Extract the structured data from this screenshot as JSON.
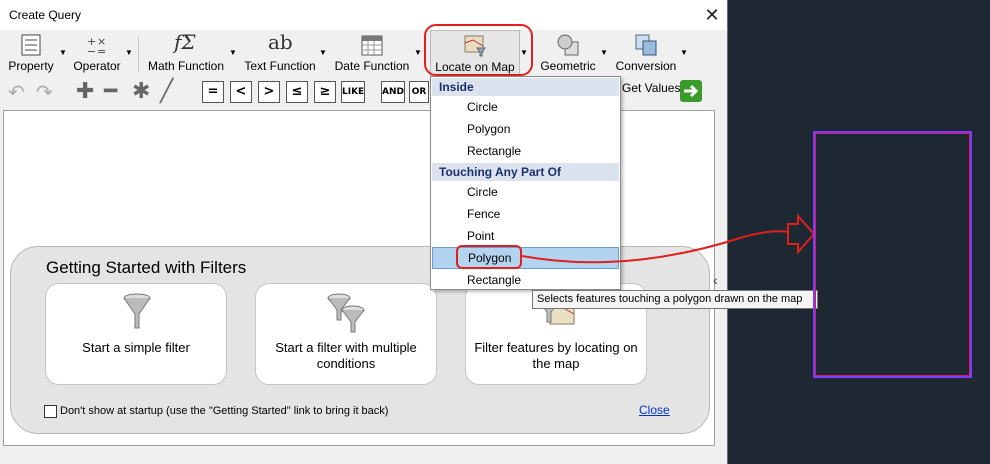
{
  "window": {
    "title": "Create Query",
    "close_glyph": "✕"
  },
  "ribbon": {
    "items": [
      {
        "label": "Property",
        "icon": "property-icon"
      },
      {
        "label": "Operator",
        "icon": "operator-icon"
      },
      {
        "label": "Math Function",
        "icon": "math-function-icon",
        "glyph": "fΣ"
      },
      {
        "label": "Text Function",
        "icon": "text-function-icon",
        "glyph": "ab"
      },
      {
        "label": "Date Function",
        "icon": "date-function-icon"
      },
      {
        "label": "Locate on Map",
        "icon": "locate-on-map-icon"
      },
      {
        "label": "Geometric",
        "icon": "geometric-icon"
      },
      {
        "label": "Conversion",
        "icon": "conversion-icon"
      }
    ]
  },
  "toolbar": {
    "get_values": "Get Values",
    "buttons": [
      "=",
      "<",
      ">",
      "≤",
      "≥",
      "LIKE",
      "AND",
      "OR"
    ]
  },
  "dropdown": {
    "section_inside": "Inside",
    "inside_items": [
      "Circle",
      "Polygon",
      "Rectangle"
    ],
    "section_touching": "Touching Any Part Of",
    "touching_items": [
      "Circle",
      "Fence",
      "Point",
      "Polygon",
      "Rectangle"
    ],
    "highlighted": "Polygon"
  },
  "tooltip": "Selects features touching a polygon drawn on the map",
  "getting_started": {
    "title": "Getting Started with Filters",
    "cards": [
      "Start a simple filter",
      "Start a filter with multiple conditions",
      "Filter features by locating on the map"
    ],
    "dont_show": "Don't show at startup (use the \"Getting Started\" link to bring it back)",
    "close": "Close"
  },
  "colors": {
    "annotation": "#e0201c",
    "map_rect": "#7a3cff",
    "highlight": "#b3d4f0"
  }
}
